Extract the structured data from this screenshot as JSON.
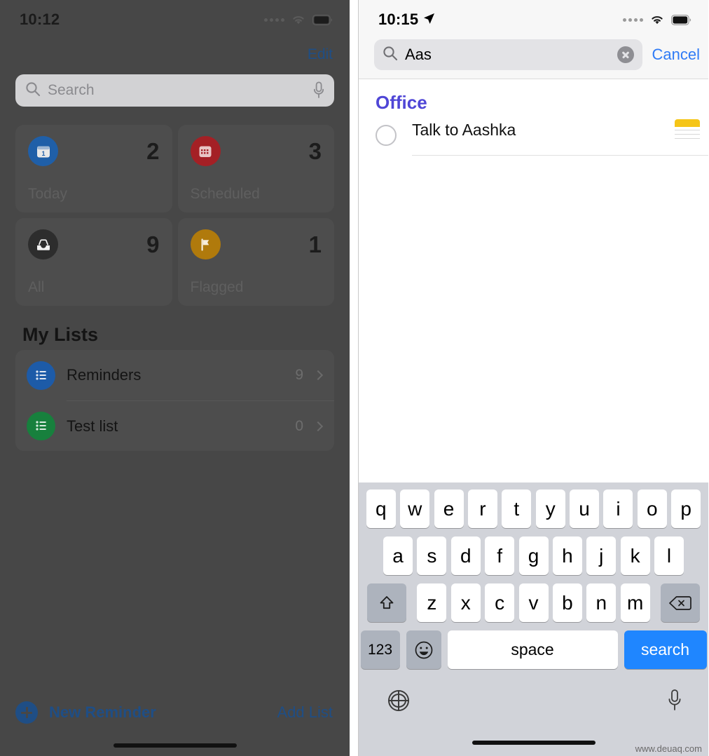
{
  "left_panel": {
    "status_bar": {
      "time": "10:12",
      "signal_icon": "signal-dots-icon",
      "wifi_icon": "wifi-icon",
      "battery_icon": "battery-icon"
    },
    "edit_label": "Edit",
    "search": {
      "placeholder": "Search",
      "search_icon": "search-icon",
      "mic_icon": "microphone-icon"
    },
    "smart_lists": [
      {
        "name": "Today",
        "count": "2",
        "icon": "calendar-today-icon",
        "color": "#1f5fa8"
      },
      {
        "name": "Scheduled",
        "count": "3",
        "icon": "calendar-scheduled-icon",
        "color": "#a42025"
      },
      {
        "name": "All",
        "count": "9",
        "icon": "inbox-all-icon",
        "color": "#2d2d2d"
      },
      {
        "name": "Flagged",
        "count": "1",
        "icon": "flag-icon",
        "color": "#b07a0c"
      }
    ],
    "my_lists_title": "My Lists",
    "lists": [
      {
        "name": "Reminders",
        "count": "9",
        "icon": "list-bullet-icon",
        "color": "#1d5ba8"
      },
      {
        "name": "Test list",
        "count": "0",
        "icon": "list-bullet-icon",
        "color": "#17803d"
      }
    ],
    "toolbar": {
      "new_reminder_label": "New Reminder",
      "new_reminder_icon": "plus-circle-icon",
      "add_list_label": "Add List"
    }
  },
  "right_panel": {
    "status_bar": {
      "time": "10:15",
      "location_icon": "location-arrow-icon",
      "signal_icon": "signal-dots-icon",
      "wifi_icon": "wifi-icon",
      "battery_icon": "battery-icon"
    },
    "search": {
      "value": "Aas",
      "search_icon": "search-icon",
      "clear_icon": "clear-circle-icon",
      "cancel_label": "Cancel"
    },
    "results": {
      "group_title": "Office",
      "group_color": "#4f46d6",
      "items": [
        {
          "title": "Talk to Aashka",
          "checkbox": "unchecked-circle-icon",
          "trailing_icon": "yellow-note-icon"
        }
      ]
    },
    "keyboard": {
      "row1": [
        "q",
        "w",
        "e",
        "r",
        "t",
        "y",
        "u",
        "i",
        "o",
        "p"
      ],
      "row2": [
        "a",
        "s",
        "d",
        "f",
        "g",
        "h",
        "j",
        "k",
        "l"
      ],
      "row3": [
        "z",
        "x",
        "c",
        "v",
        "b",
        "n",
        "m"
      ],
      "shift_icon": "shift-up-arrow-icon",
      "backspace_icon": "backspace-delete-icon",
      "numbers_label": "123",
      "emoji_icon": "emoji-smiley-icon",
      "space_label": "space",
      "search_label": "search",
      "globe_icon": "globe-language-icon",
      "dictation_icon": "microphone-icon"
    }
  },
  "watermark": "www.deuaq.com"
}
